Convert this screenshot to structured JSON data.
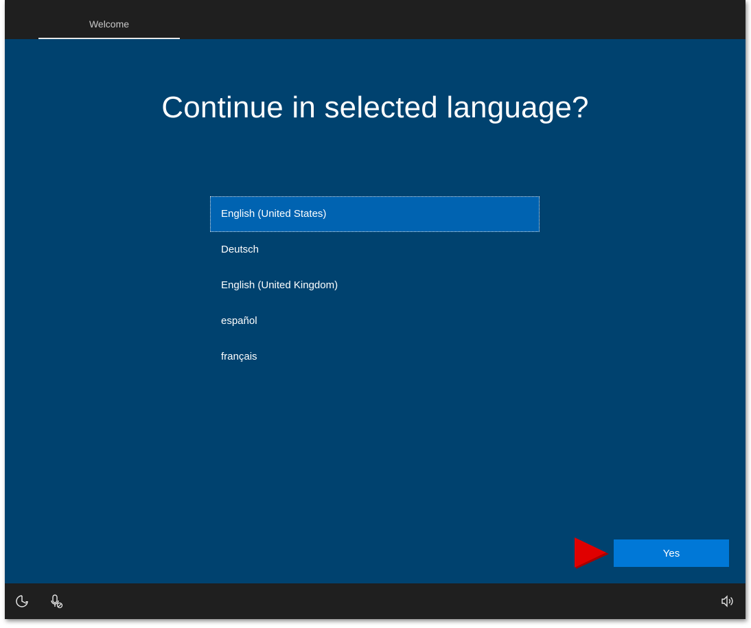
{
  "header": {
    "tab_label": "Welcome"
  },
  "main": {
    "title": "Continue in selected language?",
    "languages": [
      {
        "label": "English (United States)",
        "selected": true
      },
      {
        "label": "Deutsch",
        "selected": false
      },
      {
        "label": "English (United Kingdom)",
        "selected": false
      },
      {
        "label": "español",
        "selected": false
      },
      {
        "label": "français",
        "selected": false
      }
    ],
    "yes_label": "Yes"
  },
  "footer": {
    "icons": [
      "ease-of-access-icon",
      "microphone-off-icon",
      "volume-icon"
    ]
  },
  "colors": {
    "background": "#00426f",
    "bar": "#1f1f1f",
    "selected_item": "#0063b1",
    "button": "#0078d7",
    "arrow": "#e00000"
  }
}
